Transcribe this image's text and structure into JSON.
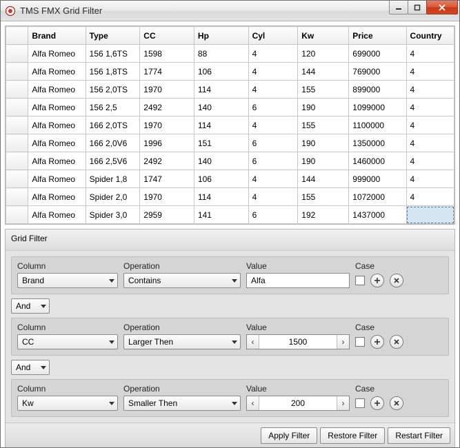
{
  "window": {
    "title": "TMS FMX Grid Filter"
  },
  "grid": {
    "columns": [
      "Brand",
      "Type",
      "CC",
      "Hp",
      "Cyl",
      "Kw",
      "Price",
      "Country"
    ],
    "rows": [
      {
        "brand": "Alfa Romeo",
        "type": "156 1,6TS",
        "cc": "1598",
        "hp": "88",
        "cyl": "4",
        "kw": "120",
        "price": "699000",
        "country": "4"
      },
      {
        "brand": "Alfa Romeo",
        "type": "156 1,8TS",
        "cc": "1774",
        "hp": "106",
        "cyl": "4",
        "kw": "144",
        "price": "769000",
        "country": "4"
      },
      {
        "brand": "Alfa Romeo",
        "type": "156 2,0TS",
        "cc": "1970",
        "hp": "114",
        "cyl": "4",
        "kw": "155",
        "price": "899000",
        "country": "4"
      },
      {
        "brand": "Alfa Romeo",
        "type": "156 2,5",
        "cc": "2492",
        "hp": "140",
        "cyl": "6",
        "kw": "190",
        "price": "1099000",
        "country": "4"
      },
      {
        "brand": "Alfa Romeo",
        "type": "166 2,0TS",
        "cc": "1970",
        "hp": "114",
        "cyl": "4",
        "kw": "155",
        "price": "1100000",
        "country": "4"
      },
      {
        "brand": "Alfa Romeo",
        "type": "166 2,0V6",
        "cc": "1996",
        "hp": "151",
        "cyl": "6",
        "kw": "190",
        "price": "1350000",
        "country": "4"
      },
      {
        "brand": "Alfa Romeo",
        "type": "166 2,5V6",
        "cc": "2492",
        "hp": "140",
        "cyl": "6",
        "kw": "190",
        "price": "1460000",
        "country": "4"
      },
      {
        "brand": "Alfa Romeo",
        "type": "Spider 1,8",
        "cc": "1747",
        "hp": "106",
        "cyl": "4",
        "kw": "144",
        "price": "999000",
        "country": "4"
      },
      {
        "brand": "Alfa Romeo",
        "type": "Spider 2,0",
        "cc": "1970",
        "hp": "114",
        "cyl": "4",
        "kw": "155",
        "price": "1072000",
        "country": "4"
      },
      {
        "brand": "Alfa Romeo",
        "type": "Spider 3,0",
        "cc": "2959",
        "hp": "141",
        "cyl": "6",
        "kw": "192",
        "price": "1437000",
        "country": ""
      }
    ],
    "selected": {
      "row": 9,
      "col": "country"
    }
  },
  "filter": {
    "panel_title": "Grid Filter",
    "labels": {
      "column": "Column",
      "operation": "Operation",
      "value": "Value",
      "case": "Case"
    },
    "rows": [
      {
        "column": "Brand",
        "operation": "Contains",
        "value_type": "text",
        "value": "Alfa",
        "case": false,
        "bool_after": "And"
      },
      {
        "column": "CC",
        "operation": "Larger Then",
        "value_type": "spinner",
        "value": "1500",
        "case": false,
        "bool_after": "And"
      },
      {
        "column": "Kw",
        "operation": "Smaller Then",
        "value_type": "spinner",
        "value": "200",
        "case": false,
        "bool_after": null
      }
    ],
    "buttons": {
      "apply": "Apply Filter",
      "restore": "Restore Filter",
      "restart": "Restart Filter"
    }
  },
  "icons": {
    "plus": "+",
    "remove": "×",
    "spin_left": "‹",
    "spin_right": "›"
  }
}
